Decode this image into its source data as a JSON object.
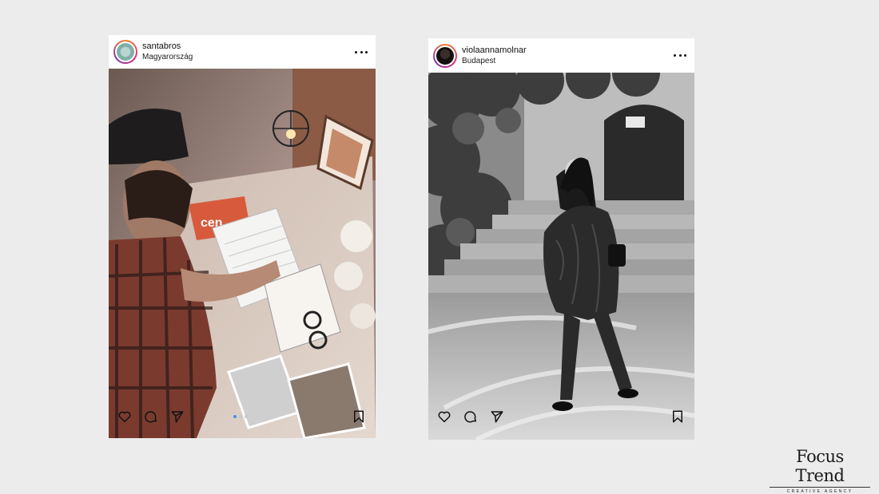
{
  "posts": [
    {
      "username": "santabros",
      "location": "Magyarország",
      "carousel": {
        "count": 3,
        "active": 1
      },
      "photo_icon": "desk-scene-photo",
      "avatar_icon": "profile-avatar"
    },
    {
      "username": "violaannamolnar",
      "location": "Budapest",
      "photo_icon": "street-portrait-photo",
      "avatar_icon": "profile-avatar"
    }
  ],
  "actions": {
    "like_icon": "heart-icon",
    "comment_icon": "comment-icon",
    "share_icon": "send-icon",
    "save_icon": "bookmark-icon",
    "more_icon": "more-icon"
  },
  "brand": {
    "name": "Focus Trend",
    "tagline": "CREATIVE AGENCY"
  },
  "colors": {
    "background": "#ececec",
    "carousel_active": "#3a93ef"
  }
}
